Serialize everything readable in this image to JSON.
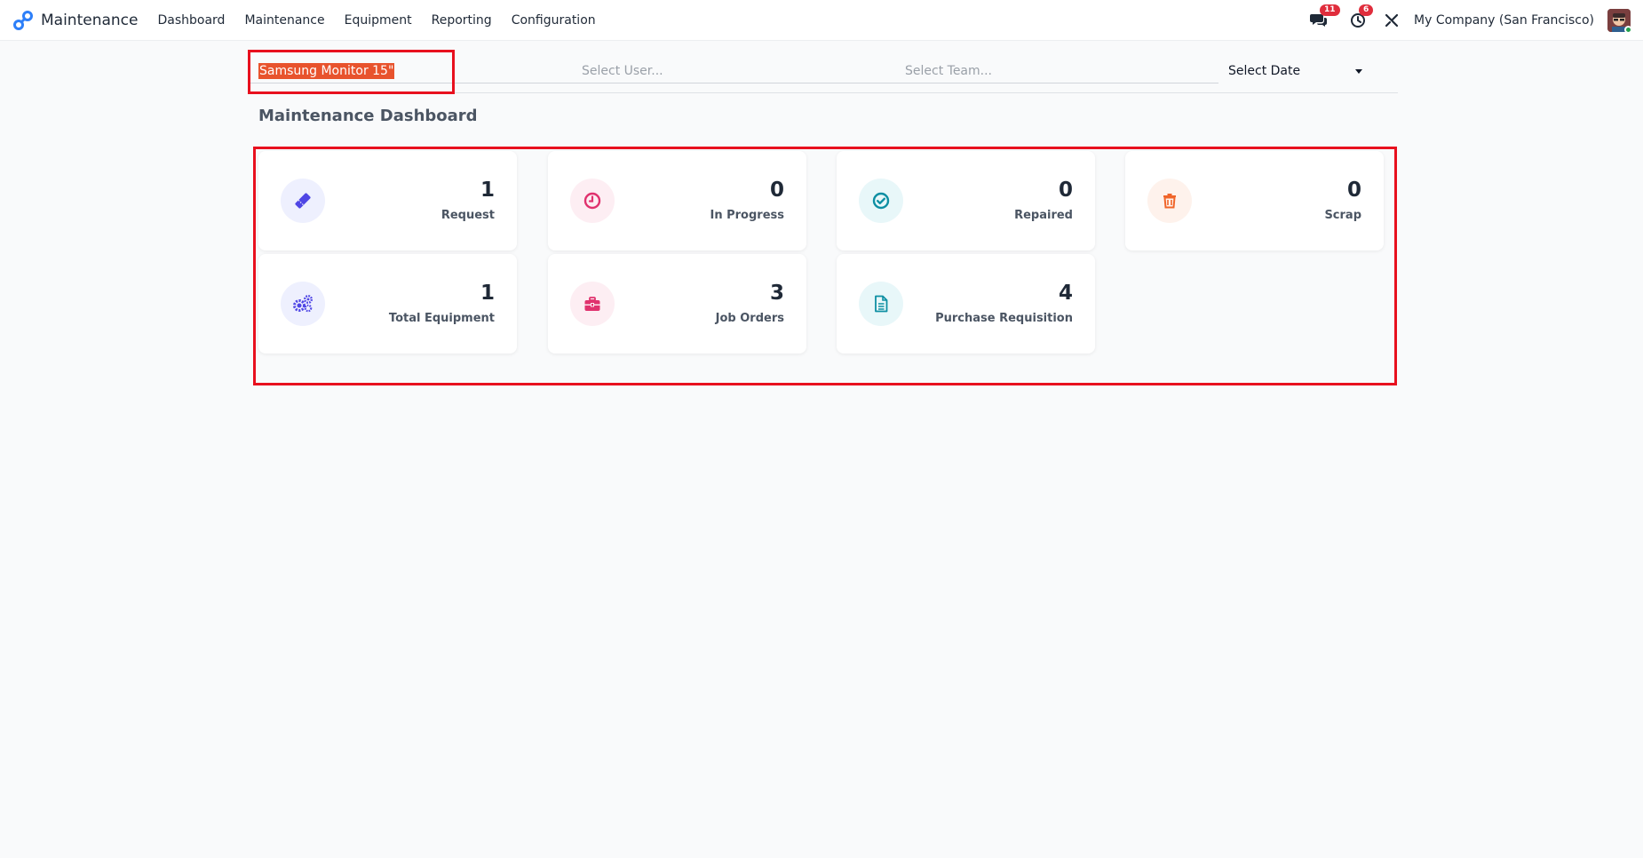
{
  "app": {
    "name": "Maintenance"
  },
  "nav": {
    "items": [
      {
        "label": "Dashboard"
      },
      {
        "label": "Maintenance"
      },
      {
        "label": "Equipment"
      },
      {
        "label": "Reporting"
      },
      {
        "label": "Configuration"
      }
    ]
  },
  "systray": {
    "messages_count": "11",
    "activities_count": "6",
    "company": "My Company (San Francisco)"
  },
  "filters": {
    "equipment_value": "Samsung Monitor 15\"",
    "user_placeholder": "Select User...",
    "team_placeholder": "Select Team...",
    "date_label": "Select Date"
  },
  "dashboard": {
    "title": "Maintenance Dashboard",
    "cards": [
      {
        "value": "1",
        "label": "Request",
        "icon": "ticket-icon",
        "color": "#4f46e5",
        "bg": "#eef0fe"
      },
      {
        "value": "0",
        "label": "In Progress",
        "icon": "clock-icon",
        "color": "#e0326e",
        "bg": "#fdeef3"
      },
      {
        "value": "0",
        "label": "Repaired",
        "icon": "check-circle-icon",
        "color": "#0e8fa3",
        "bg": "#e8f7f9"
      },
      {
        "value": "0",
        "label": "Scrap",
        "icon": "trash-icon",
        "color": "#f0652a",
        "bg": "#fef2ec"
      },
      {
        "value": "1",
        "label": "Total Equipment",
        "icon": "gears-icon",
        "color": "#4f46e5",
        "bg": "#eef0fe"
      },
      {
        "value": "3",
        "label": "Job Orders",
        "icon": "briefcase-icon",
        "color": "#e0326e",
        "bg": "#fdeef3"
      },
      {
        "value": "4",
        "label": "Purchase Requisition",
        "icon": "document-icon",
        "color": "#0e8fa3",
        "bg": "#e8f7f9"
      }
    ]
  }
}
